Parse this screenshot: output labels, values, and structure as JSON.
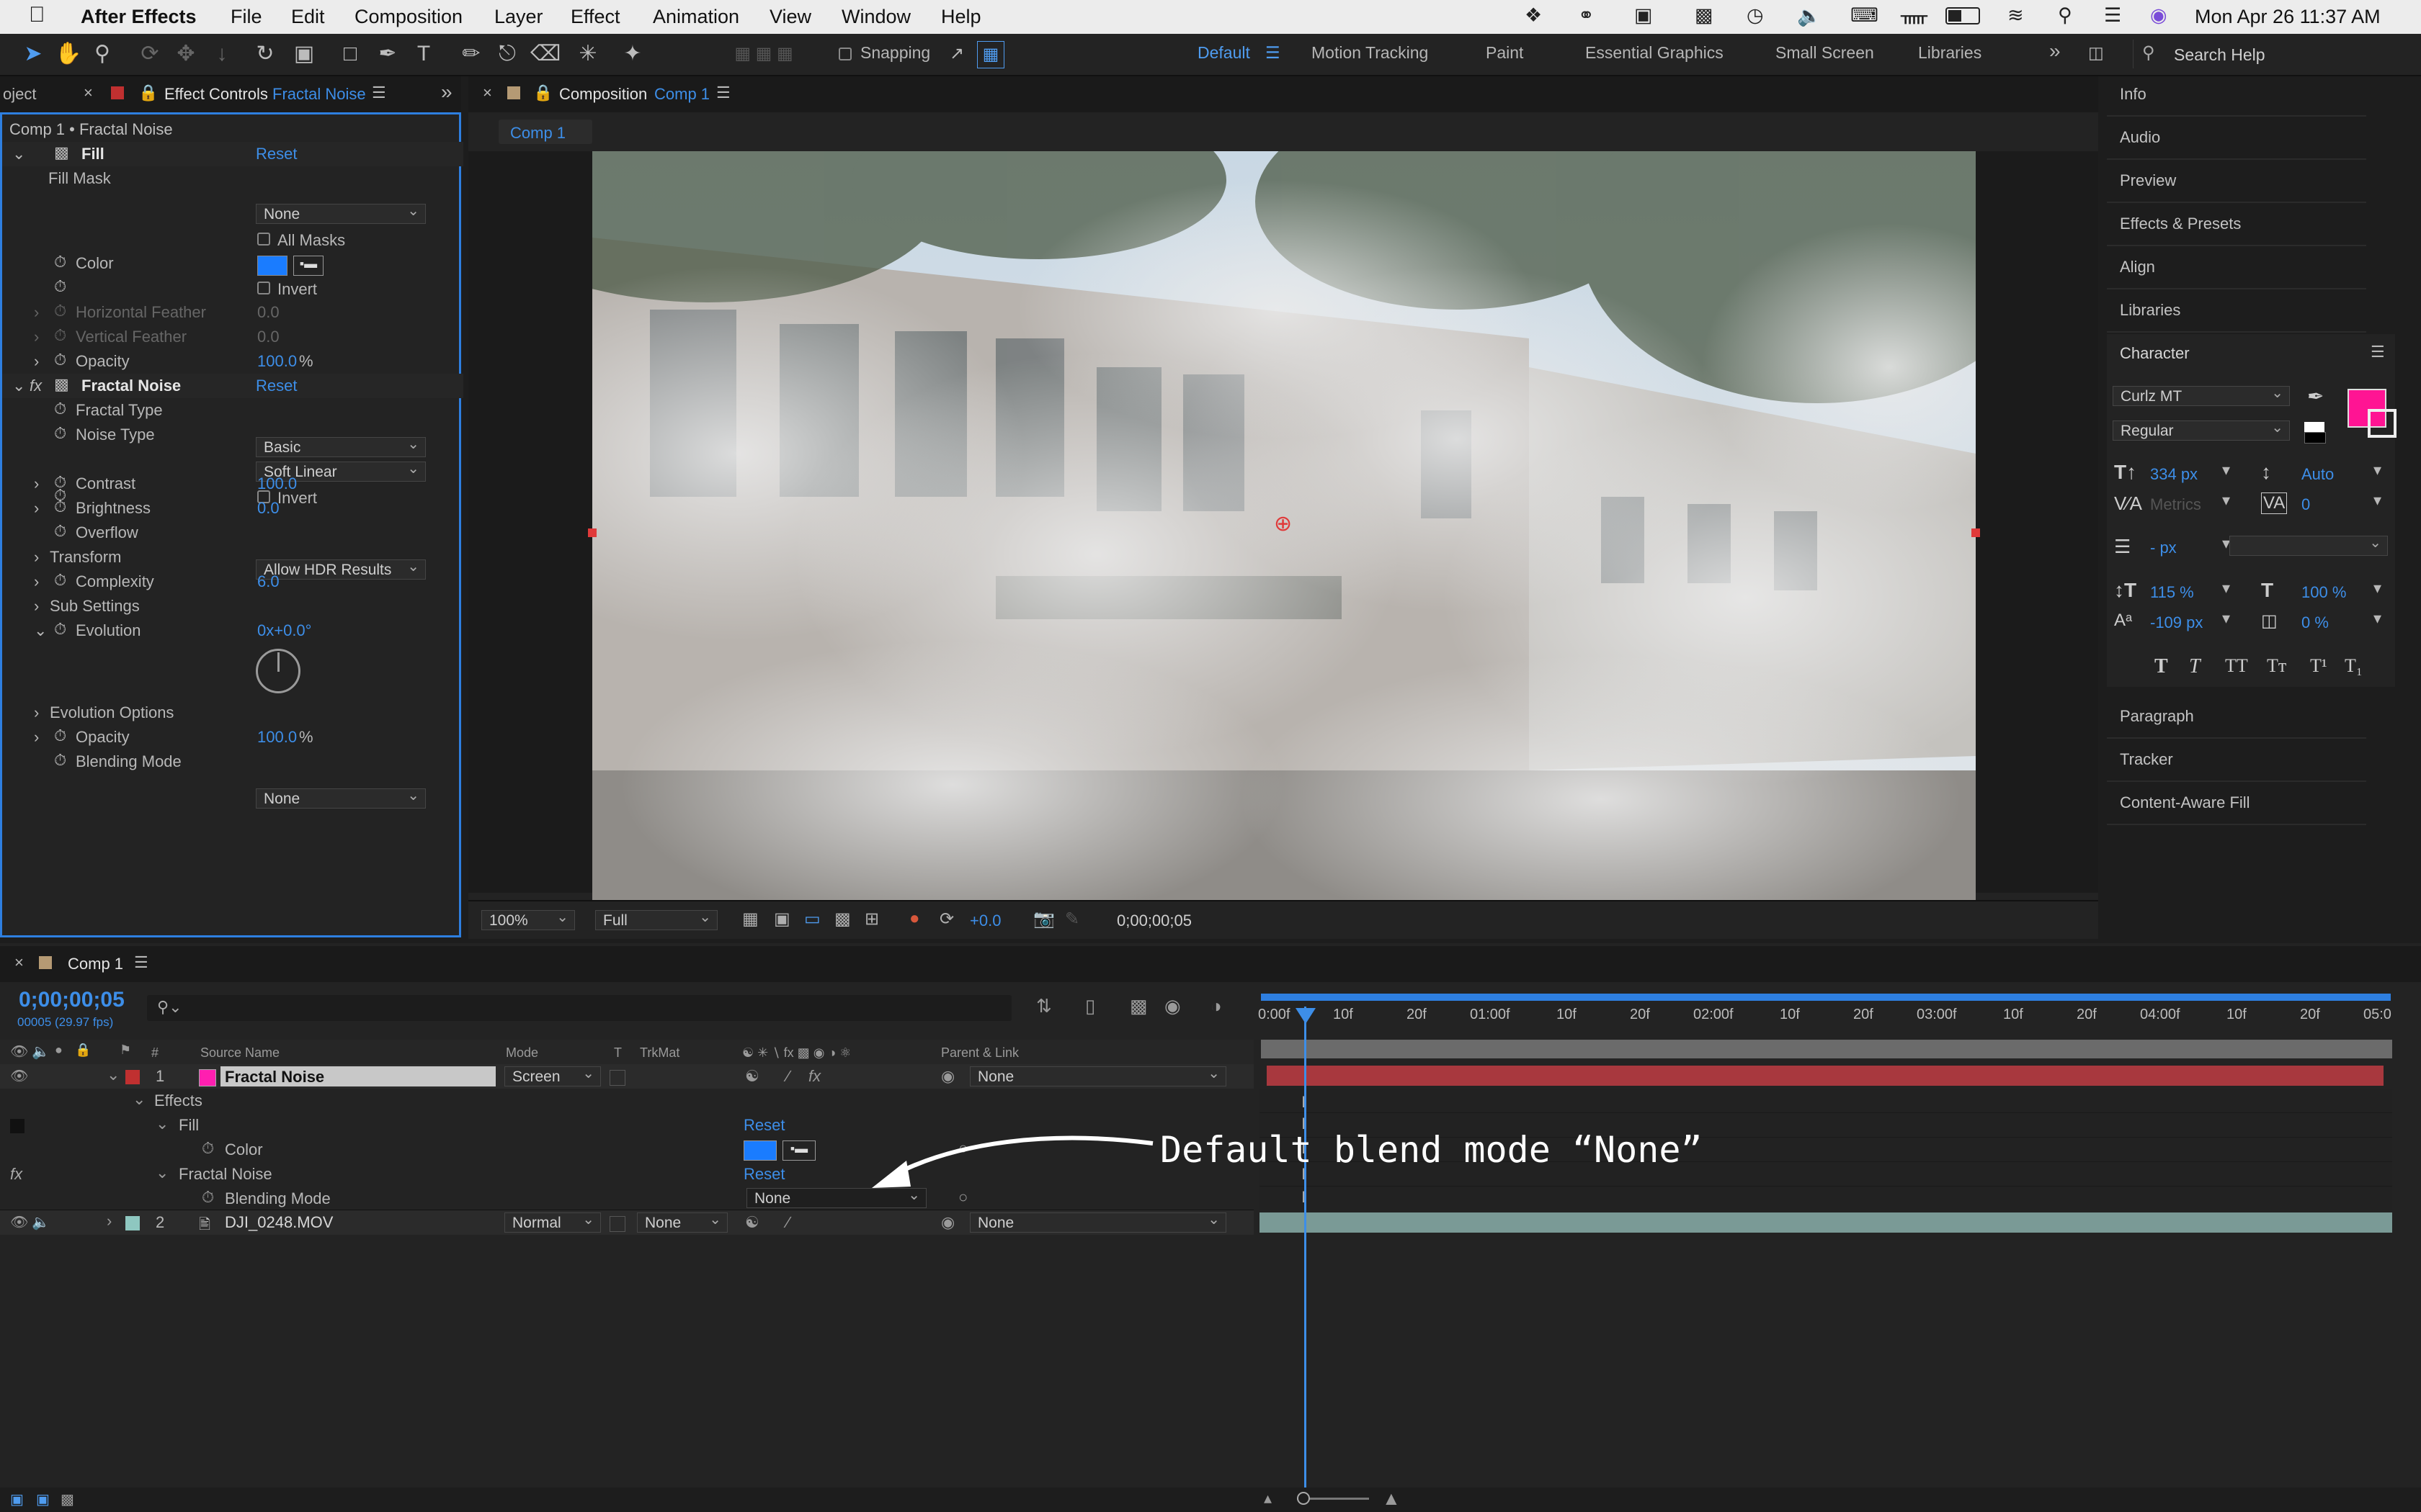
{
  "menubar": {
    "app_name": "After Effects",
    "items": [
      "File",
      "Edit",
      "Composition",
      "Layer",
      "Effect",
      "Animation",
      "View",
      "Window",
      "Help"
    ],
    "datetime": "Mon Apr 26  11:37 AM"
  },
  "toolbar": {
    "snapping_label": "Snapping",
    "workspaces": [
      "Default",
      "Motion Tracking",
      "Paint",
      "Essential Graphics",
      "Small Screen",
      "Libraries"
    ],
    "active_workspace": "Default",
    "search_placeholder": "Search Help"
  },
  "effect_controls": {
    "tab_project_truncated": "oject",
    "tab_title": "Effect Controls",
    "tab_layer": "Fractal Noise",
    "breadcrumb": "Comp 1 • Fractal Noise",
    "fill": {
      "name": "Fill",
      "reset": "Reset",
      "fill_mask_label": "Fill Mask",
      "fill_mask_value": "None",
      "all_masks_label": "All Masks",
      "color_label": "Color",
      "invert_label": "Invert",
      "h_feather_label": "Horizontal Feather",
      "h_feather_value": "0.0",
      "v_feather_label": "Vertical Feather",
      "v_feather_value": "0.0",
      "opacity_label": "Opacity",
      "opacity_value": "100.0",
      "opacity_unit": "%"
    },
    "fractal_noise": {
      "name": "Fractal Noise",
      "reset": "Reset",
      "fractal_type_label": "Fractal Type",
      "fractal_type_value": "Basic",
      "noise_type_label": "Noise Type",
      "noise_type_value": "Soft Linear",
      "invert_label": "Invert",
      "contrast_label": "Contrast",
      "contrast_value": "100.0",
      "brightness_label": "Brightness",
      "brightness_value": "0.0",
      "overflow_label": "Overflow",
      "overflow_value": "Allow HDR Results",
      "transform_label": "Transform",
      "complexity_label": "Complexity",
      "complexity_value": "6.0",
      "sub_settings_label": "Sub Settings",
      "evolution_label": "Evolution",
      "evolution_value": "0x+0.0°",
      "evolution_options_label": "Evolution Options",
      "opacity_label": "Opacity",
      "opacity_value": "100.0",
      "opacity_unit": "%",
      "blending_mode_label": "Blending Mode",
      "blending_mode_value": "None"
    },
    "fx_label": "fx"
  },
  "composition": {
    "tab_label": "Composition",
    "tab_comp": "Comp 1",
    "sub_tab": "Comp 1",
    "zoom": "100%",
    "resolution": "Full",
    "exposure": "+0.0",
    "timecode": "0;00;00;05"
  },
  "right_panels": {
    "items": [
      "Info",
      "Audio",
      "Preview",
      "Effects & Presets",
      "Align",
      "Libraries"
    ],
    "character": {
      "title": "Character",
      "font": "Curlz MT",
      "style": "Regular",
      "size": "334 px",
      "leading": "Auto",
      "kerning": "Metrics",
      "tracking": "0",
      "stroke": "- px",
      "vert_scale": "115 %",
      "horiz_scale": "100 %",
      "baseline": "-109 px",
      "tsume": "0 %",
      "fill_color": "#ff1493",
      "style_buttons": [
        "T",
        "T",
        "TT",
        "Tт",
        "T¹",
        "T₁"
      ]
    },
    "items_after": [
      "Paragraph",
      "Tracker",
      "Content-Aware Fill"
    ]
  },
  "timeline": {
    "tab": "Comp 1",
    "timecode": "0;00;00;05",
    "frame_info": "00005 (29.97 fps)",
    "headers": {
      "source_name": "Source Name",
      "mode": "Mode",
      "t": "T",
      "trkmat": "TrkMat",
      "parent": "Parent & Link",
      "num": "#"
    },
    "layers": [
      {
        "num": "1",
        "name": "Fractal Noise",
        "mode": "Screen",
        "parent": "None",
        "label_color": "#ff1fb0"
      },
      {
        "num": "2",
        "name": "DJI_0248.MOV",
        "mode": "Normal",
        "trkmat": "None",
        "parent": "None",
        "label_color": "#8ec7c0"
      }
    ],
    "sub_rows": {
      "effects": "Effects",
      "fill": "Fill",
      "color": "Color",
      "fractal_noise": "Fractal Noise",
      "blending_mode": "Blending Mode",
      "blending_value": "None",
      "reset": "Reset"
    },
    "ruler_ticks": [
      "0:00f",
      "10f",
      "20f",
      "01:00f",
      "10f",
      "20f",
      "02:00f",
      "10f",
      "20f",
      "03:00f",
      "10f",
      "20f",
      "04:00f",
      "10f",
      "20f",
      "05:0"
    ],
    "annotation": "Default blend mode “None”"
  }
}
